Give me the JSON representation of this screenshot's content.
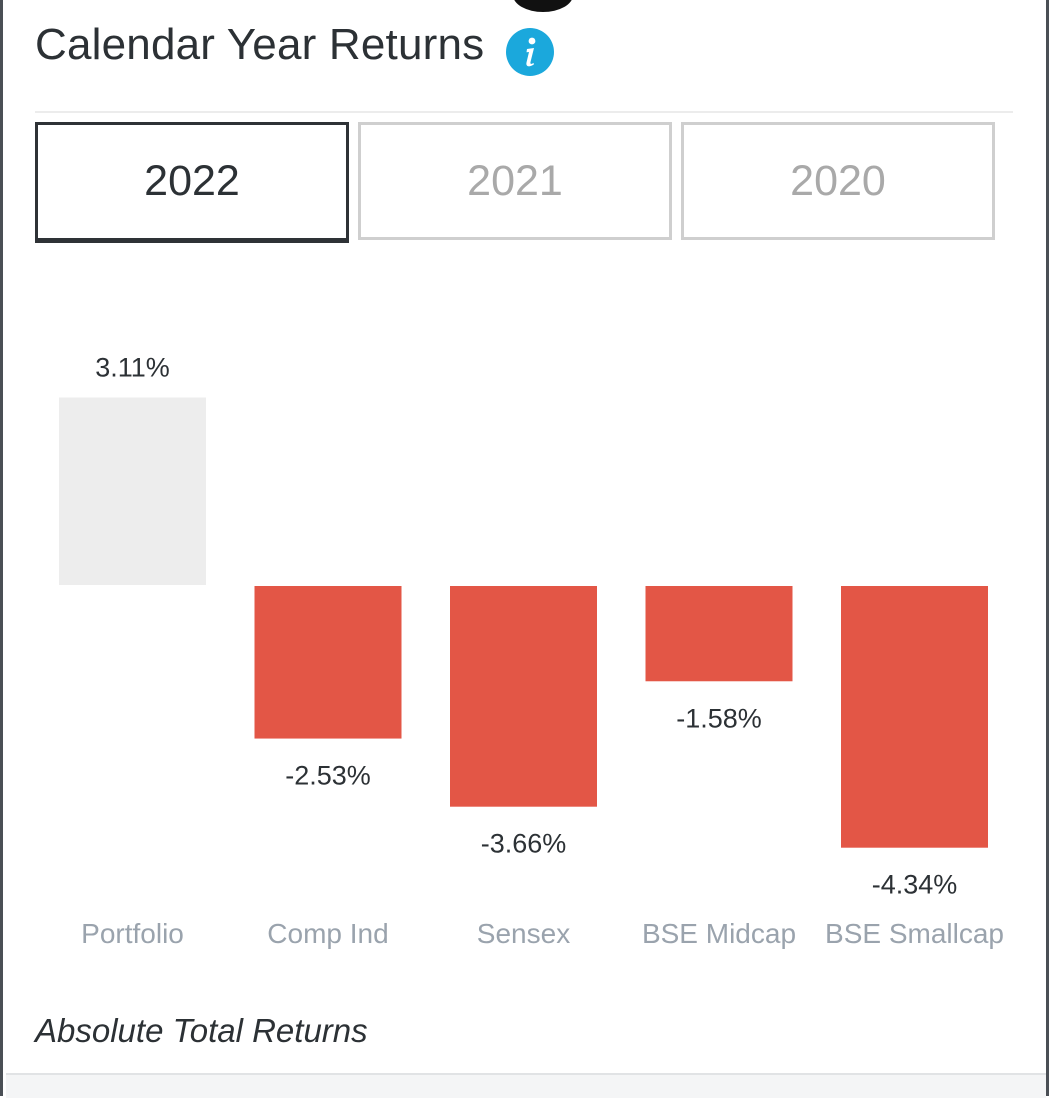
{
  "header": {
    "title": "Calendar Year Returns",
    "info_icon": "info-icon"
  },
  "tabs": [
    {
      "label": "2022",
      "active": true
    },
    {
      "label": "2021",
      "active": false
    },
    {
      "label": "2020",
      "active": false
    }
  ],
  "colors": {
    "positive_bar": "#ededed",
    "negative_bar": "#e35646",
    "label_text": "#2c3135",
    "category_text": "#9aa3ad",
    "info_accent": "#1ba8dc"
  },
  "chart_data": {
    "type": "bar",
    "categories": [
      "Portfolio",
      "Comp Ind",
      "Sensex",
      "BSE Midcap",
      "BSE Smallcap"
    ],
    "values": [
      3.11,
      -2.53,
      -3.66,
      -1.58,
      -4.34
    ],
    "value_labels": [
      "3.11%",
      "-2.53%",
      "-3.66%",
      "-1.58%",
      "-4.34%"
    ],
    "title": "",
    "xlabel": "",
    "ylabel": "",
    "grid": false,
    "legend": "none"
  },
  "footer": {
    "note": "Absolute Total Returns"
  }
}
